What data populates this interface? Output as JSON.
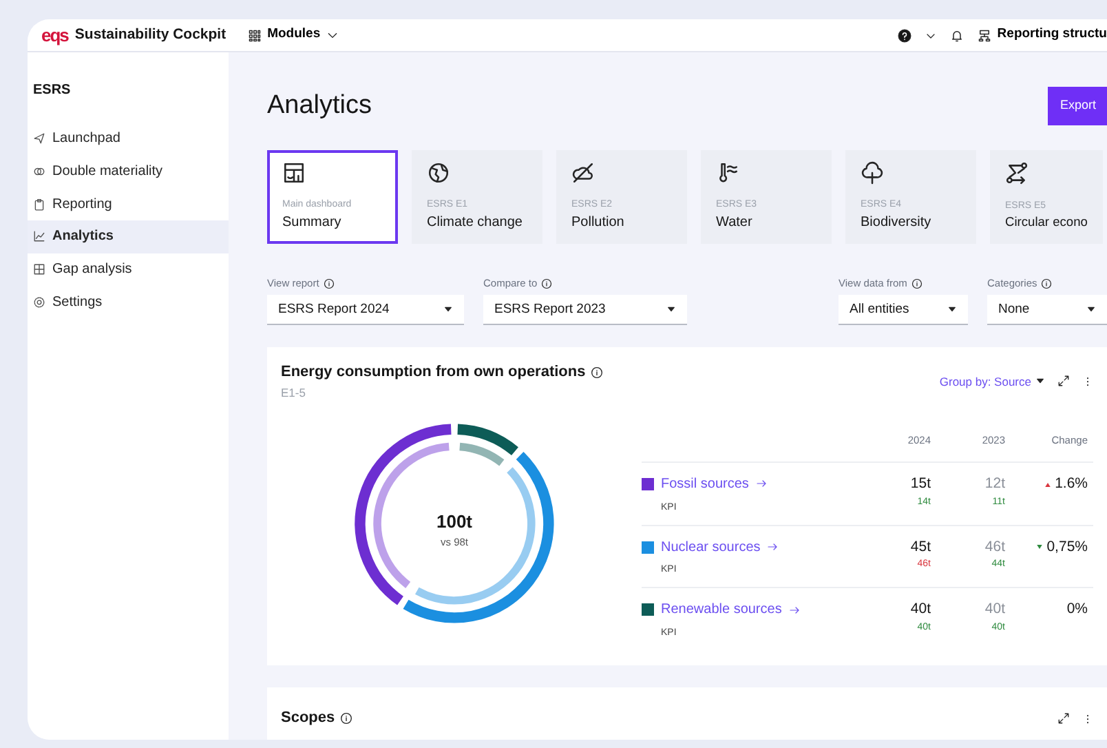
{
  "topbar": {
    "logo": "eqs",
    "app_name": "Sustainability Cockpit",
    "modules": "Modules",
    "reporting": "Reporting structu"
  },
  "sidebar": {
    "title": "ESRS",
    "items": [
      {
        "label": "Launchpad",
        "selected": false
      },
      {
        "label": "Double materiality",
        "selected": false
      },
      {
        "label": "Reporting",
        "selected": false
      },
      {
        "label": "Analytics",
        "selected": true
      },
      {
        "label": "Gap analysis",
        "selected": false
      },
      {
        "label": "Settings",
        "selected": false
      }
    ]
  },
  "page": {
    "title": "Analytics",
    "export": "Export"
  },
  "tiles": [
    {
      "code": "Main dashboard",
      "label": "Summary",
      "selected": true
    },
    {
      "code": "ESRS E1",
      "label": "Climate change",
      "selected": false
    },
    {
      "code": "ESRS E2",
      "label": "Pollution",
      "selected": false
    },
    {
      "code": "ESRS E3",
      "label": "Water",
      "selected": false
    },
    {
      "code": "ESRS E4",
      "label": "Biodiversity",
      "selected": false
    },
    {
      "code": "ESRS E5",
      "label": "Circular econo",
      "selected": false
    }
  ],
  "filters": [
    {
      "label": "View report",
      "value": "ESRS Report 2024"
    },
    {
      "label": "Compare to",
      "value": "ESRS Report 2023"
    },
    {
      "label": "View data from",
      "value": "All entities"
    },
    {
      "label": "Categories",
      "value": "None"
    }
  ],
  "energy_card": {
    "title": "Energy consumption from own operations",
    "code": "E1-5",
    "group_by": "Group by: Source",
    "total": "100t",
    "total_compare": "vs 98t",
    "columns": [
      "2024",
      "2023",
      "Change"
    ],
    "rows": [
      {
        "name": "Fossil sources",
        "color": "#6d2ed1",
        "v2024": "15t",
        "v2023": "12t",
        "change": "1.6%",
        "increase": true,
        "decrease": false,
        "kpi_label": "KPI",
        "kpi_2024": {
          "value": "14t",
          "on_target": true
        },
        "kpi_2023": {
          "value": "11t",
          "on_target": true
        }
      },
      {
        "name": "Nuclear sources",
        "color": "#1b8fe0",
        "v2024": "45t",
        "v2023": "46t",
        "change": "0,75%",
        "increase": false,
        "decrease": true,
        "kpi_label": "KPI",
        "kpi_2024": {
          "value": "46t",
          "on_target": false
        },
        "kpi_2023": {
          "value": "44t",
          "on_target": true
        }
      },
      {
        "name": "Renewable sources",
        "color": "#0d5c57",
        "v2024": "40t",
        "v2023": "40t",
        "change": "0%",
        "increase": false,
        "decrease": false,
        "kpi_label": "KPI",
        "kpi_2024": {
          "value": "40t",
          "on_target": true
        },
        "kpi_2023": {
          "value": "40t",
          "on_target": true
        }
      }
    ]
  },
  "scopes_card": {
    "title": "Scopes"
  }
}
